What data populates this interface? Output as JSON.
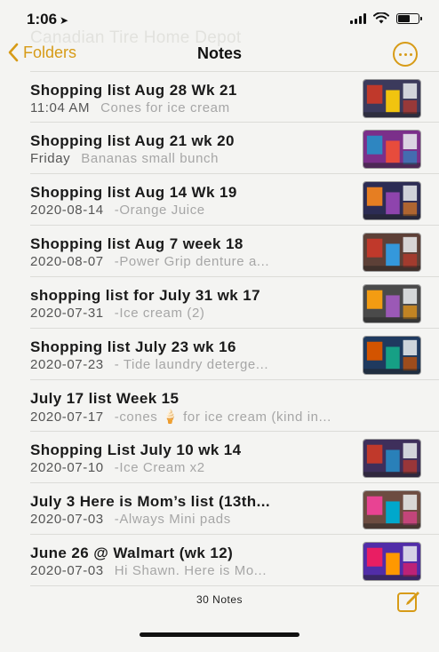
{
  "status": {
    "time": "1:06"
  },
  "ghost_text": "Canadian Tire Home Depot",
  "nav": {
    "back_label": "Folders",
    "title": "Notes"
  },
  "notes": [
    {
      "title": "Shopping list Aug 28 Wk 21",
      "date": "11:04 AM",
      "preview": "Cones for ice cream",
      "thumb": true
    },
    {
      "title": "Shopping list Aug 21 wk 20",
      "date": "Friday",
      "preview": "Bananas small bunch",
      "thumb": true
    },
    {
      "title": "Shopping list Aug 14 Wk 19",
      "date": "2020-08-14",
      "preview": "-Orange Juice",
      "thumb": true
    },
    {
      "title": "Shopping list Aug 7 week 18",
      "date": "2020-08-07",
      "preview": "-Power Grip denture a...",
      "thumb": true
    },
    {
      "title": "shopping list for July 31 wk 17",
      "date": "2020-07-31",
      "preview": "-Ice cream (2)",
      "thumb": true
    },
    {
      "title": "Shopping list July 23 wk 16",
      "date": "2020-07-23",
      "preview": "- Tide laundry deterge...",
      "thumb": true
    },
    {
      "title": "July 17 list Week 15",
      "date": "2020-07-17",
      "preview": "-cones 🍦 for ice cream (kind in...",
      "thumb": false
    },
    {
      "title": "Shopping List July 10 wk 14",
      "date": "2020-07-10",
      "preview": "-Ice Cream x2",
      "thumb": true
    },
    {
      "title": "July 3 Here is Mom’s list (13th...",
      "date": "2020-07-03",
      "preview": "-Always Mini pads",
      "thumb": true
    },
    {
      "title": "June 26 @ Walmart (wk 12)",
      "date": "2020-07-03",
      "preview": "Hi Shawn. Here is Mo...",
      "thumb": true
    }
  ],
  "footer": {
    "count_label": "30 Notes"
  },
  "colors": {
    "accent": "#d79b17",
    "background": "#f4f4f2",
    "secondary_text": "#a6a6a6"
  }
}
